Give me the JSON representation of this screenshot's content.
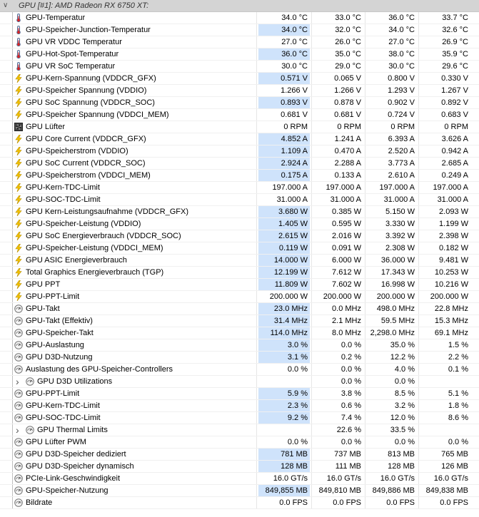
{
  "header": {
    "title": "GPU [#1]: AMD Radeon RX 6750 XT:"
  },
  "rows": [
    {
      "label": "GPU-Temperatur",
      "icon": "thermometer-icon",
      "v": [
        "34.0 °C",
        "33.0 °C",
        "36.0 °C",
        "33.7 °C"
      ],
      "hl": false
    },
    {
      "label": "GPU-Speicher-Junction-Temperatur",
      "icon": "thermometer-icon",
      "v": [
        "34.0 °C",
        "32.0 °C",
        "34.0 °C",
        "32.6 °C"
      ],
      "hl": true
    },
    {
      "label": "GPU VR VDDC Temperatur",
      "icon": "thermometer-icon",
      "v": [
        "27.0 °C",
        "26.0 °C",
        "27.0 °C",
        "26.9 °C"
      ],
      "hl": false
    },
    {
      "label": "GPU-Hot-Spot-Temperatur",
      "icon": "thermometer-icon",
      "v": [
        "36.0 °C",
        "35.0 °C",
        "38.0 °C",
        "35.9 °C"
      ],
      "hl": true
    },
    {
      "label": "GPU VR SoC Temperatur",
      "icon": "thermometer-icon",
      "v": [
        "30.0 °C",
        "29.0 °C",
        "30.0 °C",
        "29.6 °C"
      ],
      "hl": false
    },
    {
      "label": "GPU-Kern-Spannung (VDDCR_GFX)",
      "icon": "lightning-icon",
      "v": [
        "0.571 V",
        "0.065 V",
        "0.800 V",
        "0.330 V"
      ],
      "hl": true
    },
    {
      "label": "GPU-Speicher Spannung (VDDIO)",
      "icon": "lightning-icon",
      "v": [
        "1.266 V",
        "1.266 V",
        "1.293 V",
        "1.267 V"
      ],
      "hl": false
    },
    {
      "label": "GPU SoC Spannung (VDDCR_SOC)",
      "icon": "lightning-icon",
      "v": [
        "0.893 V",
        "0.878 V",
        "0.902 V",
        "0.892 V"
      ],
      "hl": true
    },
    {
      "label": "GPU-Speicher Spannung (VDDCI_MEM)",
      "icon": "lightning-icon",
      "v": [
        "0.681 V",
        "0.681 V",
        "0.724 V",
        "0.683 V"
      ],
      "hl": false
    },
    {
      "label": "GPU Lüfter",
      "icon": "fan-icon",
      "v": [
        "0 RPM",
        "0 RPM",
        "0 RPM",
        "0 RPM"
      ],
      "hl": false
    },
    {
      "label": "GPU Core Current (VDDCR_GFX)",
      "icon": "lightning-icon",
      "v": [
        "4.852 A",
        "1.241 A",
        "6.393 A",
        "3.626 A"
      ],
      "hl": true
    },
    {
      "label": "GPU-Speicherstrom (VDDIO)",
      "icon": "lightning-icon",
      "v": [
        "1.109 A",
        "0.470 A",
        "2.520 A",
        "0.942 A"
      ],
      "hl": true
    },
    {
      "label": "GPU SoC Current (VDDCR_SOC)",
      "icon": "lightning-icon",
      "v": [
        "2.924 A",
        "2.288 A",
        "3.773 A",
        "2.685 A"
      ],
      "hl": true
    },
    {
      "label": "GPU-Speicherstrom (VDDCI_MEM)",
      "icon": "lightning-icon",
      "v": [
        "0.175 A",
        "0.133 A",
        "2.610 A",
        "0.249 A"
      ],
      "hl": true
    },
    {
      "label": "GPU-Kern-TDC-Limit",
      "icon": "lightning-icon",
      "v": [
        "197.000 A",
        "197.000 A",
        "197.000 A",
        "197.000 A"
      ],
      "hl": false
    },
    {
      "label": "GPU-SOC-TDC-Limit",
      "icon": "lightning-icon",
      "v": [
        "31.000 A",
        "31.000 A",
        "31.000 A",
        "31.000 A"
      ],
      "hl": false
    },
    {
      "label": "GPU Kern-Leistungsaufnahme (VDDCR_GFX)",
      "icon": "lightning-icon",
      "v": [
        "3.680 W",
        "0.385 W",
        "5.150 W",
        "2.093 W"
      ],
      "hl": true
    },
    {
      "label": "GPU-Speicher-Leistung (VDDIO)",
      "icon": "lightning-icon",
      "v": [
        "1.405 W",
        "0.595 W",
        "3.330 W",
        "1.199 W"
      ],
      "hl": true
    },
    {
      "label": "GPU SoC Energieverbrauch (VDDCR_SOC)",
      "icon": "lightning-icon",
      "v": [
        "2.615 W",
        "2.016 W",
        "3.392 W",
        "2.398 W"
      ],
      "hl": true
    },
    {
      "label": "GPU-Speicher-Leistung (VDDCI_MEM)",
      "icon": "lightning-icon",
      "v": [
        "0.119 W",
        "0.091 W",
        "2.308 W",
        "0.182 W"
      ],
      "hl": true
    },
    {
      "label": "GPU ASIC Energieverbrauch",
      "icon": "lightning-icon",
      "v": [
        "14.000 W",
        "6.000 W",
        "36.000 W",
        "9.481 W"
      ],
      "hl": true
    },
    {
      "label": "Total Graphics Energieverbrauch (TGP)",
      "icon": "lightning-icon",
      "v": [
        "12.199 W",
        "7.612 W",
        "17.343 W",
        "10.253 W"
      ],
      "hl": true
    },
    {
      "label": "GPU PPT",
      "icon": "lightning-icon",
      "v": [
        "11.809 W",
        "7.602 W",
        "16.998 W",
        "10.216 W"
      ],
      "hl": true
    },
    {
      "label": "GPU-PPT-Limit",
      "icon": "lightning-icon",
      "v": [
        "200.000 W",
        "200.000 W",
        "200.000 W",
        "200.000 W"
      ],
      "hl": false
    },
    {
      "label": "GPU-Takt",
      "icon": "gauge-icon",
      "v": [
        "23.0 MHz",
        "0.0 MHz",
        "498.0 MHz",
        "22.8 MHz"
      ],
      "hl": true
    },
    {
      "label": "GPU-Takt (Effektiv)",
      "icon": "gauge-icon",
      "v": [
        "31.4 MHz",
        "2.1 MHz",
        "59.5 MHz",
        "15.3 MHz"
      ],
      "hl": true
    },
    {
      "label": "GPU-Speicher-Takt",
      "icon": "gauge-icon",
      "v": [
        "114.0 MHz",
        "8.0 MHz",
        "2,298.0 MHz",
        "69.1 MHz"
      ],
      "hl": true
    },
    {
      "label": "GPU-Auslastung",
      "icon": "gauge-icon",
      "v": [
        "3.0 %",
        "0.0 %",
        "35.0 %",
        "1.5 %"
      ],
      "hl": true
    },
    {
      "label": "GPU D3D-Nutzung",
      "icon": "gauge-icon",
      "v": [
        "3.1 %",
        "0.2 %",
        "12.2 %",
        "2.2 %"
      ],
      "hl": true
    },
    {
      "label": "Auslastung des GPU-Speicher-Controllers",
      "icon": "gauge-icon",
      "v": [
        "0.0 %",
        "0.0 %",
        "4.0 %",
        "0.1 %"
      ],
      "hl": false
    },
    {
      "label": "GPU D3D Utilizations",
      "icon": "gauge-icon",
      "group": true,
      "v": [
        "",
        "0.0 %",
        "0.0 %",
        ""
      ],
      "hl": false
    },
    {
      "label": "GPU-PPT-Limit",
      "icon": "gauge-icon",
      "v": [
        "5.9 %",
        "3.8 %",
        "8.5 %",
        "5.1 %"
      ],
      "hl": true
    },
    {
      "label": "GPU-Kern-TDC-Limit",
      "icon": "gauge-icon",
      "v": [
        "2.3 %",
        "0.6 %",
        "3.2 %",
        "1.8 %"
      ],
      "hl": true
    },
    {
      "label": "GPU-SOC-TDC-Limit",
      "icon": "gauge-icon",
      "v": [
        "9.2 %",
        "7.4 %",
        "12.0 %",
        "8.6 %"
      ],
      "hl": true
    },
    {
      "label": "GPU Thermal Limits",
      "icon": "gauge-icon",
      "group": true,
      "v": [
        "",
        "22.6 %",
        "33.5 %",
        ""
      ],
      "hl": false
    },
    {
      "label": "GPU Lüfter PWM",
      "icon": "gauge-icon",
      "v": [
        "0.0 %",
        "0.0 %",
        "0.0 %",
        "0.0 %"
      ],
      "hl": false
    },
    {
      "label": "GPU D3D-Speicher dediziert",
      "icon": "gauge-icon",
      "v": [
        "781 MB",
        "737 MB",
        "813 MB",
        "765 MB"
      ],
      "hl": true
    },
    {
      "label": "GPU D3D-Speicher dynamisch",
      "icon": "gauge-icon",
      "v": [
        "128 MB",
        "111 MB",
        "128 MB",
        "126 MB"
      ],
      "hl": true
    },
    {
      "label": "PCIe-Link-Geschwindigkeit",
      "icon": "gauge-icon",
      "v": [
        "16.0 GT/s",
        "16.0 GT/s",
        "16.0 GT/s",
        "16.0 GT/s"
      ],
      "hl": false
    },
    {
      "label": "GPU-Speicher-Nutzung",
      "icon": "gauge-icon",
      "v": [
        "849,855 MB",
        "849,810 MB",
        "849,886 MB",
        "849,838 MB"
      ],
      "hl": true
    },
    {
      "label": "Bildrate",
      "icon": "gauge-icon",
      "v": [
        "0.0 FPS",
        "0.0 FPS",
        "0.0 FPS",
        "0.0 FPS"
      ],
      "hl": false
    }
  ]
}
